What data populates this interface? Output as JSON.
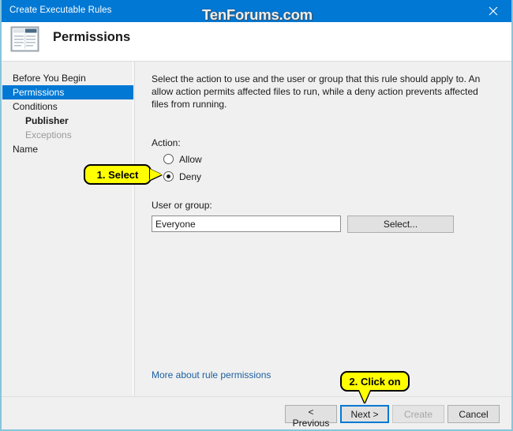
{
  "window": {
    "title": "Create Executable Rules",
    "close_icon": "close-icon",
    "accent_color": "#0078d4",
    "body_color": "#f0f0f0",
    "border_color": "#86c5dc"
  },
  "header": {
    "title": "Permissions",
    "icon": "window-list-icon"
  },
  "watermark": {
    "text": "TenForums.com"
  },
  "sidebar": {
    "items": [
      {
        "label": "Before You Begin",
        "selected": false,
        "sub": false,
        "muted": false
      },
      {
        "label": "Permissions",
        "selected": true,
        "sub": false,
        "muted": false
      },
      {
        "label": "Conditions",
        "selected": false,
        "sub": false,
        "muted": false
      },
      {
        "label": "Publisher",
        "selected": false,
        "sub": true,
        "muted": false
      },
      {
        "label": "Exceptions",
        "selected": false,
        "sub": true,
        "muted": true
      },
      {
        "label": "Name",
        "selected": false,
        "sub": false,
        "muted": false
      }
    ]
  },
  "main": {
    "intro_text": "Select the action to use and the user or group that this rule should apply to. An allow action permits affected files to run, while a deny action prevents affected files from running.",
    "action": {
      "label": "Action:",
      "options": [
        {
          "label": "Allow",
          "selected": false
        },
        {
          "label": "Deny",
          "selected": true
        }
      ],
      "selected_value": "Deny"
    },
    "user_or_group": {
      "label": "User or group:",
      "value": "Everyone",
      "placeholder": "",
      "select_button_label": "Select..."
    },
    "more_link_label": "More about rule permissions"
  },
  "footer": {
    "buttons": [
      {
        "label": "< Previous",
        "state": "enabled"
      },
      {
        "label": "Next >",
        "state": "focused"
      },
      {
        "label": "Create",
        "state": "disabled"
      },
      {
        "label": "Cancel",
        "state": "enabled"
      }
    ]
  },
  "callouts": [
    {
      "text": "1. Select",
      "points_to": "deny-radio",
      "direction": "right"
    },
    {
      "text": "2. Click on",
      "points_to": "next-button",
      "direction": "down"
    }
  ]
}
